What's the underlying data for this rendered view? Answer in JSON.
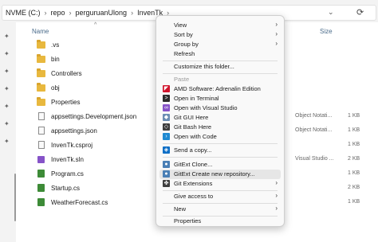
{
  "address": {
    "crumbs": [
      "NVME (C:)",
      "repo",
      "perguruanUlong",
      "InvenTk"
    ],
    "dropdown_glyph": "⌄",
    "refresh_glyph": "⟳"
  },
  "columns": {
    "name": "Name",
    "size": "Size",
    "sort_glyph": "^"
  },
  "files": [
    {
      "name": ".vs",
      "icon": "folder-icon",
      "type": "",
      "size": ""
    },
    {
      "name": "bin",
      "icon": "folder-icon",
      "type": "",
      "size": ""
    },
    {
      "name": "Controllers",
      "icon": "folder-icon",
      "type": "",
      "size": ""
    },
    {
      "name": "obj",
      "icon": "folder-icon",
      "type": "",
      "size": ""
    },
    {
      "name": "Properties",
      "icon": "folder-icon",
      "type": "",
      "size": ""
    },
    {
      "name": "appsettings.Development.json",
      "icon": "json-file-icon",
      "type": "Object Notati...",
      "size": "1 KB"
    },
    {
      "name": "appsettings.json",
      "icon": "json-file-icon",
      "type": "Object Notati...",
      "size": "1 KB"
    },
    {
      "name": "InvenTk.csproj",
      "icon": "csproj-file-icon",
      "type": "",
      "size": "1 KB"
    },
    {
      "name": "InvenTk.sln",
      "icon": "sln-file-icon",
      "type": "Visual Studio ...",
      "size": "2 KB"
    },
    {
      "name": "Program.cs",
      "icon": "cs-file-icon",
      "type": "",
      "size": "1 KB"
    },
    {
      "name": "Startup.cs",
      "icon": "cs-file-icon",
      "type": "",
      "size": "2 KB"
    },
    {
      "name": "WeatherForecast.cs",
      "icon": "cs-file-icon",
      "type": "",
      "size": "1 KB"
    }
  ],
  "menu": {
    "view": "View",
    "sort_by": "Sort by",
    "group_by": "Group by",
    "refresh": "Refresh",
    "customize": "Customize this folder...",
    "paste": "Paste",
    "amd": "AMD Software: Adrenalin Edition",
    "terminal": "Open in Terminal",
    "visual_studio": "Open with Visual Studio",
    "git_gui": "Git GUI Here",
    "git_bash": "Git Bash Here",
    "vscode": "Open with Code",
    "send_copy": "Send a copy...",
    "gitext_clone": "GitExt Clone...",
    "gitext_create": "GitExt Create new repository...",
    "git_extensions": "Git Extensions",
    "give_access": "Give access to",
    "new": "New",
    "properties": "Properties",
    "arrow": "›"
  },
  "colors": {
    "folder": "#e8b83e",
    "amd": "#d0142c",
    "vscode": "#1f8ad2",
    "visual_studio": "#8653c8",
    "highlight": "#e6e6e6"
  }
}
